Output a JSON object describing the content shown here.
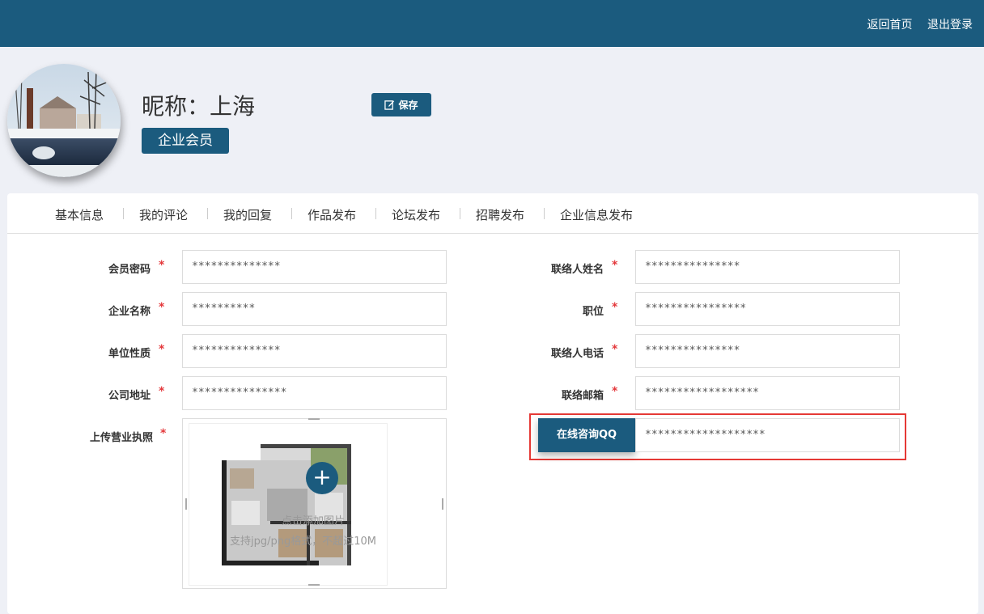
{
  "header": {
    "links": [
      "返回首页",
      "退出登录"
    ]
  },
  "profile": {
    "nickname": "昵称：上海",
    "member_type": "企业会员",
    "save_label": "保存"
  },
  "tabs": [
    "基本信息",
    "我的评论",
    "我的回复",
    "作品发布",
    "论坛发布",
    "招聘发布",
    "企业信息发布"
  ],
  "form": {
    "left": [
      {
        "label": "会员密码",
        "value": "**************"
      },
      {
        "label": "企业名称",
        "value": "**********"
      },
      {
        "label": "单位性质",
        "value": "**************"
      },
      {
        "label": "公司地址",
        "value": "***************"
      }
    ],
    "right": [
      {
        "label": "联络人姓名",
        "value": "***************"
      },
      {
        "label": "职位",
        "value": "****************"
      },
      {
        "label": "联络人电话",
        "value": "***************"
      },
      {
        "label": "联络邮箱",
        "value": "******************"
      }
    ],
    "required_mark": "*",
    "upload": {
      "label": "上传营业执照",
      "hint1": "点击添加图片",
      "hint2": "支持jpg/png格式，不超过10M",
      "plus": "+"
    },
    "qq": {
      "button_label": "在线咨询QQ",
      "value": "*******************"
    }
  },
  "colors": {
    "primary": "#1b5b7e",
    "required": "#e4393c",
    "highlight": "#e53935"
  }
}
